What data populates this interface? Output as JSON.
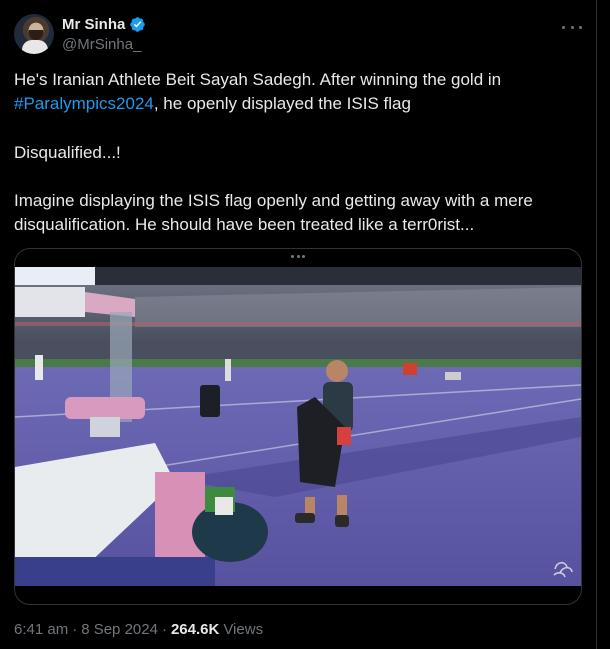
{
  "author": {
    "display_name": "Mr Sinha",
    "handle": "@MrSinha_",
    "verified": true,
    "avatar_icon": "profile-avatar"
  },
  "tweet": {
    "line1": "He's Iranian Athlete Beit Sayah Sadegh. After winning the gold in",
    "hashtag": "#Paralympics2024",
    "line2_rest": ", he openly displayed the ISIS flag",
    "line3": "Disqualified...!",
    "line4": "Imagine displaying the ISIS flag openly and getting away with a mere",
    "line5": "disqualification. He should have been treated like a terr0rist..."
  },
  "media": {
    "type": "video-still",
    "watermark_icon": "paralympics-agitos-logo"
  },
  "meta": {
    "time": "6:41 am",
    "separator": "·",
    "date": "8 Sep 2024",
    "views_count": "264.6K",
    "views_label": "Views"
  },
  "colors": {
    "background": "#000000",
    "text": "#e7e9ea",
    "muted": "#71767b",
    "link": "#1d9bf0",
    "verified": "#1d9bf0",
    "border": "#2f3336"
  }
}
